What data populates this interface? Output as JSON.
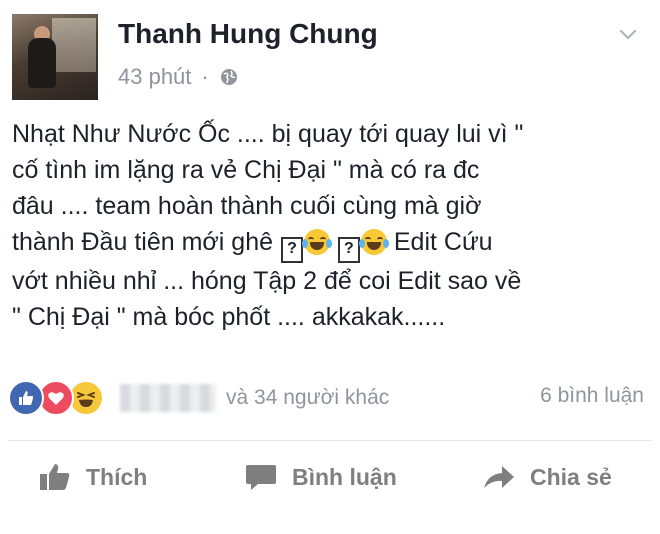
{
  "post": {
    "author": "Thanh Hung Chung",
    "time": "43 phút",
    "separator": "·",
    "lines": [
      "Nhạt Như Nước Ốc .... bị quay tới quay lui vì \"",
      "cố tình im lặng ra vẻ Chị Đại \" mà có ra đc",
      "đâu .... team hoàn thành cuối cùng mà giờ",
      "thành Đầu tiên mới ghê",
      "vớt nhiều nhỉ ... hóng Tập 2 để coi Edit sao về",
      "\" Chị Đại \" mà bóc phốt .... akkakak......"
    ],
    "line4_tail": "Edit  Cứu",
    "unknown_glyph": "?"
  },
  "reactions": {
    "others_text": "và 34 người khác",
    "comments_text": "6 bình luận"
  },
  "actions": {
    "like": "Thích",
    "comment": "Bình luận",
    "share": "Chia sẻ"
  },
  "icons": {
    "menu": "chevron-down-icon",
    "privacy": "globe-icon",
    "like": "thumbs-up-icon",
    "comment": "speech-bubble-icon",
    "share": "share-arrow-icon"
  },
  "colors": {
    "like_blue": "#4267b2",
    "love_red": "#ed4b5f",
    "haha_yellow": "#f7c83c",
    "meta_gray": "#90949c"
  }
}
